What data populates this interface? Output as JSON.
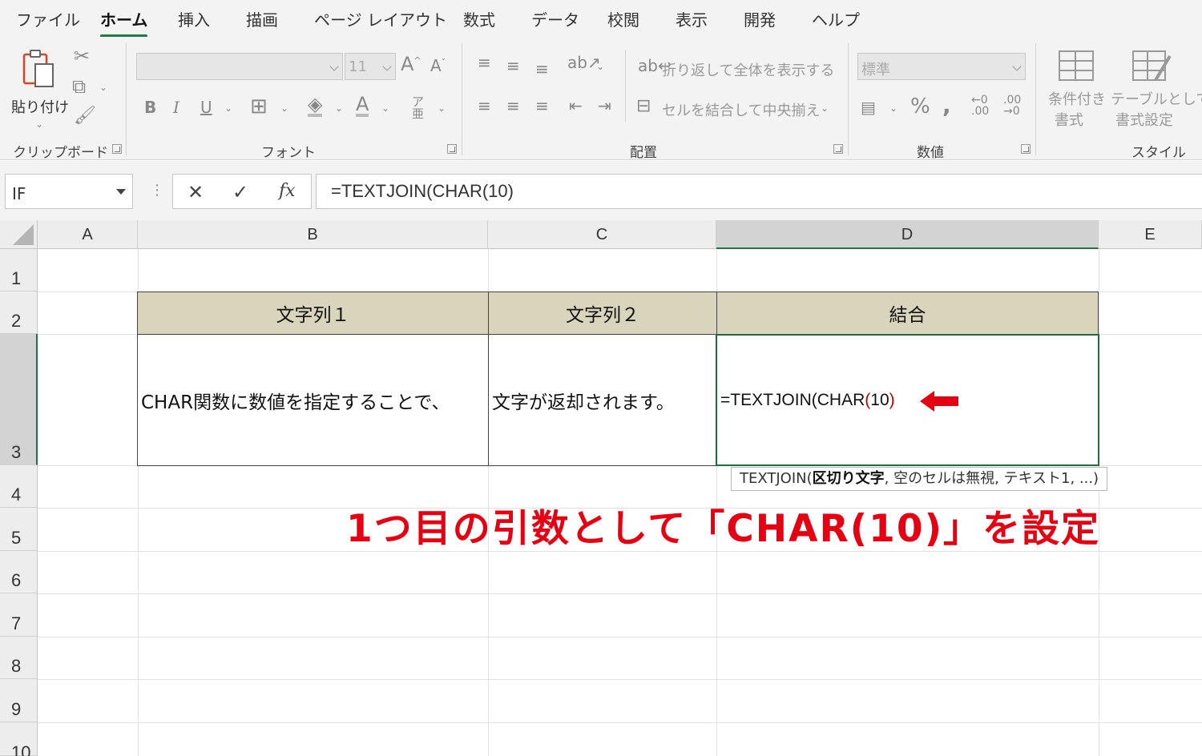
{
  "menu": {
    "tabs": [
      "ファイル",
      "ホーム",
      "挿入",
      "描画",
      "ページ レイアウト",
      "数式",
      "データ",
      "校閲",
      "表示",
      "開発",
      "ヘルプ"
    ],
    "active_tab": "ホーム"
  },
  "ribbon": {
    "clipboard": {
      "label": "クリップボード",
      "paste_label": "貼り付け"
    },
    "font": {
      "label": "フォント",
      "font_name": "",
      "font_size": "11",
      "bold": "B",
      "italic": "I",
      "underline": "U"
    },
    "alignment": {
      "label": "配置",
      "wrap_text": "折り返して全体を表示する",
      "merge_center": "セルを結合して中央揃え"
    },
    "number": {
      "label": "数値",
      "format": "標準"
    },
    "styles": {
      "label": "スタイル",
      "conditional_line1": "条件付き",
      "conditional_line2": "書式",
      "table_line1": "テーブルとして",
      "table_line2": "書式設定"
    }
  },
  "formula_bar": {
    "name_box": "IF",
    "cancel_icon": "✕",
    "enter_icon": "✓",
    "fx_label": "fx",
    "formula": "=TEXTJOIN(CHAR(10)"
  },
  "columns": [
    "A",
    "B",
    "C",
    "D",
    "E"
  ],
  "rows": [
    "1",
    "2",
    "3",
    "4",
    "5",
    "6",
    "7",
    "8",
    "9",
    "10"
  ],
  "table": {
    "headers": [
      "文字列１",
      "文字列２",
      "結合"
    ],
    "row3": {
      "b": "CHAR関数に数値を指定することで、",
      "c": "文字が返却されます。",
      "d_prefix": "=TEXTJOIN(CHAR",
      "d_paren_open": "(",
      "d_arg": "10",
      "d_paren_close": ")"
    }
  },
  "tooltip": {
    "func": "TEXTJOIN(",
    "arg_bold": "区切り文字",
    "rest": ", 空のセルは無視, テキスト1, ...)"
  },
  "annotation": "1つ目の引数として「CHAR(10)」を設定",
  "colors": {
    "accent_green": "#217346",
    "annotation_red": "#e50012",
    "header_fill": "#d9d5bd"
  }
}
